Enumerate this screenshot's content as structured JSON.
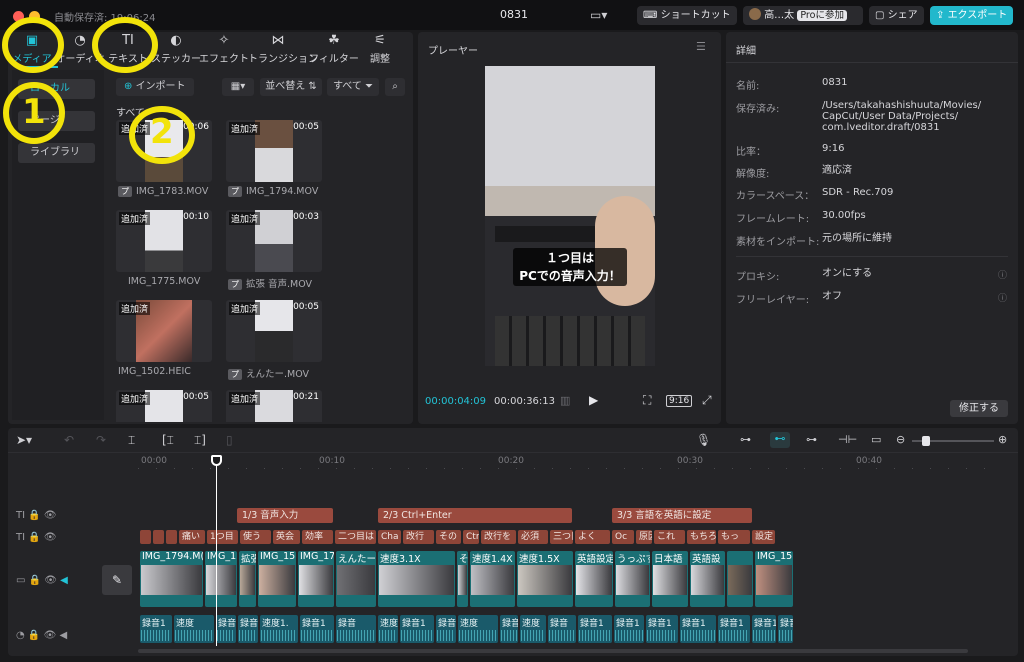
{
  "window": {
    "autosave": "自動保存済: 19:06:24",
    "project_name": "0831",
    "shortcut_label": "ショートカット",
    "user_name": "高…太",
    "pro_label": "Proに参加",
    "share_label": "シェア",
    "export_label": "エクスポート"
  },
  "toolbar": {
    "tabs": [
      {
        "label": "メディア",
        "icon": "media-icon"
      },
      {
        "label": "オーディオ",
        "icon": "audio-icon"
      },
      {
        "label": "テキスト",
        "icon": "text-icon"
      },
      {
        "label": "ステッカー",
        "icon": "sticker-icon"
      },
      {
        "label": "エフェクト",
        "icon": "effect-icon"
      },
      {
        "label": "トランジション",
        "icon": "transition-icon"
      },
      {
        "label": "フィルター",
        "icon": "filter-icon"
      },
      {
        "label": "調整",
        "icon": "adjust-icon"
      }
    ],
    "active_color": "#22c3d6"
  },
  "annotations": {
    "mark1": "1",
    "mark2": "2",
    "color": "#f2e30a"
  },
  "media": {
    "sidebar": [
      "ローカル",
      "ページ",
      "ライブラリ"
    ],
    "import_label": "インポート",
    "sort_label": "並べ替え",
    "filter_label": "すべて",
    "section_label": "すべて",
    "clips": [
      {
        "name": "",
        "added": "追加済",
        "duration": "00:06",
        "badge": "プ",
        "file": "IMG_1783.MOV"
      },
      {
        "name": "",
        "added": "追加済",
        "duration": "00:05",
        "badge": "プ",
        "file": "IMG_1794.MOV"
      },
      {
        "name": "",
        "added": "追加済",
        "duration": "00:10",
        "badge": "",
        "file": "IMG_1775.MOV"
      },
      {
        "name": "",
        "added": "追加済",
        "duration": "00:03",
        "badge": "プ",
        "file": "拡張 音声.MOV"
      },
      {
        "name": "",
        "added": "追加済",
        "duration": "",
        "badge": "",
        "file": "IMG_1502.HEIC"
      },
      {
        "name": "",
        "added": "追加済",
        "duration": "00:05",
        "badge": "プ",
        "file": "えんたー.MOV"
      },
      {
        "name": "",
        "added": "追加済",
        "duration": "00:05",
        "badge": "",
        "file": ""
      },
      {
        "name": "",
        "added": "追加済",
        "duration": "00:21",
        "badge": "",
        "file": ""
      }
    ]
  },
  "player": {
    "title": "プレーヤー",
    "caption_line1": "１つ目は",
    "caption_line2": "PCでの音声入力！",
    "current_time": "00:00:04:09",
    "total_time": "00:00:36:13",
    "ratio_label": "9:16"
  },
  "details": {
    "title": "詳細",
    "rows": [
      {
        "label": "名前:",
        "value": "0831"
      },
      {
        "label": "保存済み:",
        "value": "/Users/takahashishuuta/Movies/ CapCut/User Data/Projects/ com.lveditor.draft/0831"
      },
      {
        "label": "比率：",
        "value": "9:16"
      },
      {
        "label": "解像度:",
        "value": "適応済"
      },
      {
        "label": "カラースペース：",
        "value": "SDR - Rec.709"
      },
      {
        "label": "フレームレート:",
        "value": "30.00fps"
      },
      {
        "label": "素材をインポート:",
        "value": "元の場所に維持"
      },
      {
        "label": "プロキシ:",
        "value": "オンにする"
      },
      {
        "label": "フリーレイヤー:",
        "value": "オフ"
      }
    ],
    "edit_label": "修正する"
  },
  "timeline": {
    "ticks": [
      "00:00",
      "00:10",
      "00:20",
      "00:30",
      "00:40"
    ],
    "titles": [
      "1/3 音声入力",
      "2/3 Ctrl+Enter",
      "3/3 言語を英語に設定"
    ],
    "texts": [
      "",
      "",
      "",
      "痛い",
      "1つ目",
      "使う",
      "英会",
      "効率",
      "二つ目は",
      "Cha",
      "改行",
      "その",
      "Ctrl+E",
      "改行を",
      "必須",
      "三つ目は",
      "よく",
      "Oc",
      "原因は",
      "これ",
      "もちろ",
      "もっ",
      "設定"
    ],
    "videos": [
      "IMG_1794.M(",
      "IMG_1",
      "拡張",
      "IMG_15",
      "IMG_17",
      "えんたー.",
      "速度3.1X",
      "そ",
      "速度1.4X",
      "速度1.5X",
      "英語設定",
      "うっぷす",
      "日本語",
      "英語設",
      "",
      "IMG_15"
    ],
    "audios": [
      "録音1",
      "速度",
      "録音1",
      "録音1",
      "速度1.",
      "録音1",
      "録音",
      "速度",
      "録音1",
      "録音",
      "速度",
      "録音1",
      "速度",
      "録音",
      "録音1",
      "録音1",
      "録音1",
      "録音1",
      "録音1",
      "録音1",
      "録音1"
    ]
  }
}
